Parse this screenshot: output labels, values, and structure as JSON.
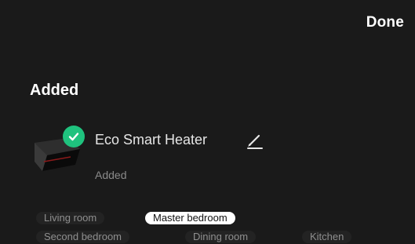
{
  "header": {
    "done_label": "Done"
  },
  "section": {
    "title": "Added"
  },
  "device": {
    "name": "Eco Smart Heater",
    "status": "Added",
    "icons": {
      "thumbnail": "heater-image",
      "badge": "check-icon",
      "edit": "pencil-icon"
    },
    "accent_color": "#1fc27e"
  },
  "rooms": {
    "items": [
      {
        "label": "Living room",
        "selected": false
      },
      {
        "label": "Master bedroom",
        "selected": true
      },
      {
        "label": "Second bedroom",
        "selected": false
      },
      {
        "label": "Dining room",
        "selected": false
      },
      {
        "label": "Kitchen",
        "selected": false
      }
    ]
  }
}
